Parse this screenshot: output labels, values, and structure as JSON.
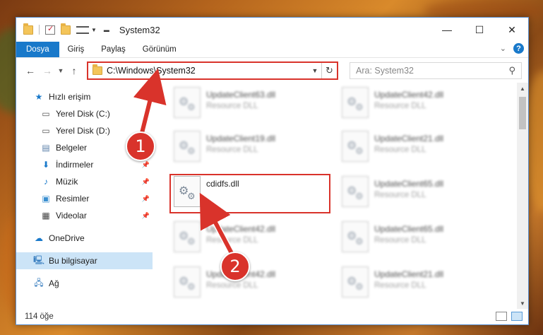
{
  "window": {
    "title": "System32",
    "controls": {
      "minimize": "—",
      "maximize": "☐",
      "close": "✕"
    }
  },
  "ribbon": {
    "tabs": [
      "Dosya",
      "Giriş",
      "Paylaş",
      "Görünüm"
    ],
    "help": "?"
  },
  "address_bar": {
    "path": "C:\\Windows\\System32",
    "refresh": "↻"
  },
  "search": {
    "placeholder": "Ara: System32"
  },
  "nav_pane": {
    "quick_access": "Hızlı erişim",
    "items": [
      {
        "label": "Yerel Disk (C:)",
        "icon": "drive-icon"
      },
      {
        "label": "Yerel Disk (D:)",
        "icon": "drive-icon"
      },
      {
        "label": "Belgeler",
        "icon": "documents-icon"
      },
      {
        "label": "İndirmeler",
        "icon": "download-icon"
      },
      {
        "label": "Müzik",
        "icon": "music-icon"
      },
      {
        "label": "Resimler",
        "icon": "pictures-icon"
      },
      {
        "label": "Videolar",
        "icon": "videos-icon"
      }
    ],
    "onedrive": "OneDrive",
    "this_pc": "Bu bilgisayar",
    "network": "Ağ"
  },
  "files": [
    {
      "name": "UpdateClient63.dll",
      "type": "Resource DLL",
      "blurred": true
    },
    {
      "name": "UpdateClient42.dll",
      "type": "Resource DLL",
      "blurred": true
    },
    {
      "name": "UpdateClient19.dll",
      "type": "Resource DLL",
      "blurred": true
    },
    {
      "name": "UpdateClient21.dll",
      "type": "Resource DLL",
      "blurred": true
    },
    {
      "name": "cdidfs.dll",
      "type": "",
      "blurred": false
    },
    {
      "name": "UpdateClient65.dll",
      "type": "Resource DLL",
      "blurred": true
    },
    {
      "name": "UpdateClient42.dll",
      "type": "Resource DLL",
      "blurred": true
    },
    {
      "name": "UpdateClient65.dll",
      "type": "Resource DLL",
      "blurred": true
    },
    {
      "name": "UpdateClient42.dll",
      "type": "Resource DLL",
      "blurred": true
    },
    {
      "name": "UpdateClient21.dll",
      "type": "Resource DLL",
      "blurred": true
    }
  ],
  "status": {
    "item_count": "114 öğe"
  },
  "callouts": [
    "1",
    "2"
  ],
  "colors": {
    "accent": "#1979ca",
    "highlight": "#d9332b",
    "selected": "#cce4f7"
  }
}
